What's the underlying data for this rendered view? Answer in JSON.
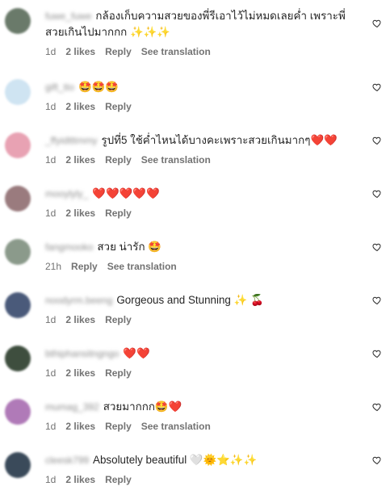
{
  "comments": [
    {
      "user": "fuwe_fuwe",
      "text": "กล้องเก็บความสวยของพี่รีเอาไว้ไม่หมดเลยค่ำ เพราะพี่สวยเกินไปมากกก ✨✨✨",
      "time": "1d",
      "likes": "2 likes",
      "reply": "Reply",
      "translate": "See translation",
      "avatar": "#6a7a6a"
    },
    {
      "user": "gift_tto",
      "text": "🤩🤩🤩",
      "time": "1d",
      "likes": "2 likes",
      "reply": "Reply",
      "translate": "",
      "avatar": "#cfe4f2"
    },
    {
      "user": "_ffyidtttmmy",
      "text": "รูปที่5 ใช้ค่ำไหนได้บางคะเพราะสวยเกินมากๆ❤️❤️",
      "time": "1d",
      "likes": "2 likes",
      "reply": "Reply",
      "translate": "See translation",
      "avatar": "#e8a2b3"
    },
    {
      "user": "mooylyly_",
      "text": "❤️❤️❤️❤️❤️",
      "time": "1d",
      "likes": "2 likes",
      "reply": "Reply",
      "translate": "",
      "avatar": "#9a7b7e"
    },
    {
      "user": "fangmooko",
      "text": "สวย น่ารัก 🤩",
      "time": "21h",
      "likes": "",
      "reply": "Reply",
      "translate": "See translation",
      "avatar": "#8b9a8b"
    },
    {
      "user": "noodyrm.beeng",
      "text": "Gorgeous and Stunning ✨ 🍒",
      "time": "1d",
      "likes": "2 likes",
      "reply": "Reply",
      "translate": "",
      "avatar": "#4a5a7a"
    },
    {
      "user": "bthiphansitngngo",
      "text": "❤️❤️",
      "time": "1d",
      "likes": "2 likes",
      "reply": "Reply",
      "translate": "",
      "avatar": "#3e4e3e"
    },
    {
      "user": "mumag_392",
      "text": "สวยมากกก🤩❤️",
      "time": "1d",
      "likes": "2 likes",
      "reply": "Reply",
      "translate": "See translation",
      "avatar": "#b07ab8"
    },
    {
      "user": "cleesk799",
      "text": "Absolutely beautiful 🤍🌞⭐✨✨",
      "time": "1d",
      "likes": "2 likes",
      "reply": "Reply",
      "translate": "",
      "avatar": "#3a4a5a"
    }
  ]
}
